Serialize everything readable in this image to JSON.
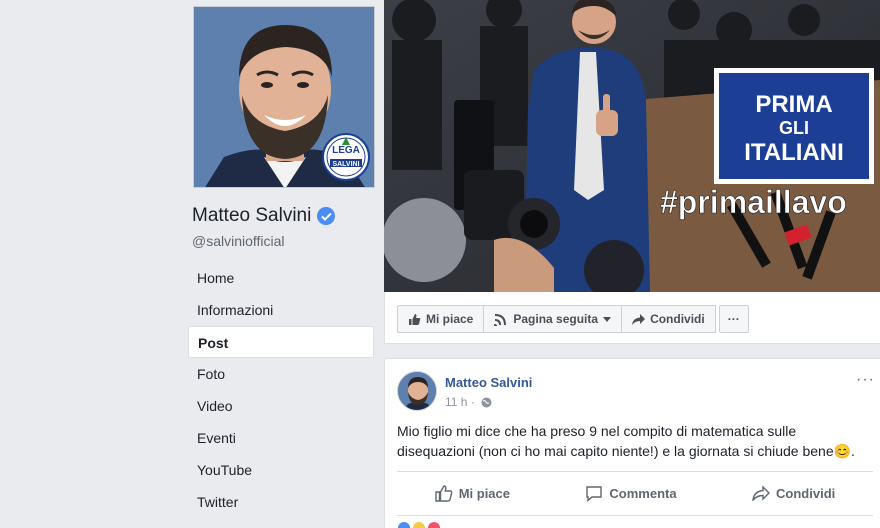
{
  "profile": {
    "name": "Matteo Salvini",
    "handle": "@salviniofficial",
    "badge_logo_text": "LEGA SALVINI"
  },
  "nav": {
    "items": [
      {
        "label": "Home",
        "active": false
      },
      {
        "label": "Informazioni",
        "active": false
      },
      {
        "label": "Post",
        "active": true
      },
      {
        "label": "Foto",
        "active": false
      },
      {
        "label": "Video",
        "active": false
      },
      {
        "label": "Eventi",
        "active": false
      },
      {
        "label": "YouTube",
        "active": false
      },
      {
        "label": "Twitter",
        "active": false
      }
    ]
  },
  "cover": {
    "banner_line1": "PRIMA",
    "banner_line2": "GLI",
    "banner_line3": "ITALIANI",
    "hashtag": "#primaillavo"
  },
  "cover_actions": {
    "like_label": "Mi piace",
    "follow_label": "Pagina seguita",
    "share_label": "Condividi",
    "more_label": "···"
  },
  "post": {
    "author": "Matteo Salvini",
    "time": "11 h ·",
    "menu_label": "···",
    "text": "Mio figlio mi dice che ha preso 9 nel compito di matematica sulle disequazioni (non ci ho mai capito niente!) e la giornata si chiude bene😊.",
    "like_label": "Mi piace",
    "comment_label": "Commenta",
    "share_label": "Condividi"
  },
  "colors": {
    "brand_blue": "#365899",
    "banner_blue": "#1c3f95",
    "page_bg": "#e9ebee"
  }
}
